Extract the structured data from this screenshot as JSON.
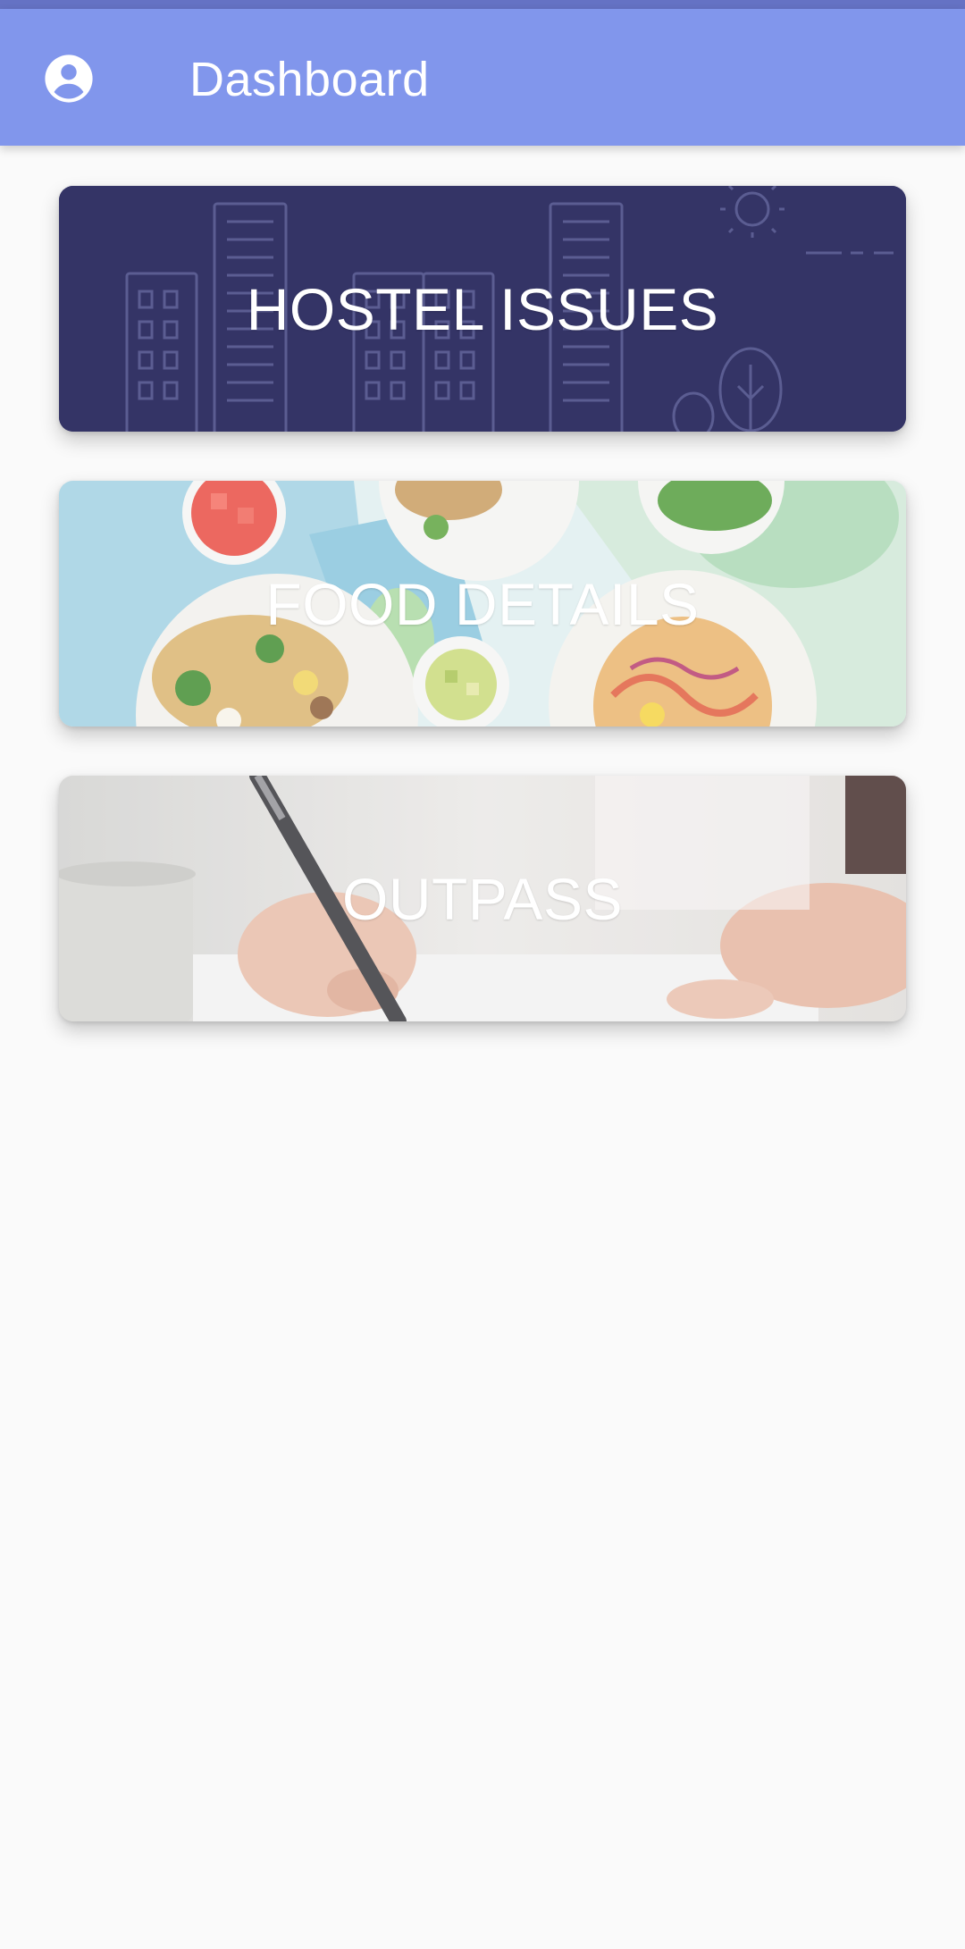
{
  "app_bar": {
    "title": "Dashboard",
    "account_icon": "account-circle-icon",
    "color": "#8196ec"
  },
  "cards": [
    {
      "label": "HOSTEL ISSUES",
      "background": "city-buildings-illustration",
      "color": "#343466"
    },
    {
      "label": "FOOD DETAILS",
      "background": "food-plates-photo"
    },
    {
      "label": "OUTPASS",
      "background": "hand-writing-photo"
    }
  ]
}
